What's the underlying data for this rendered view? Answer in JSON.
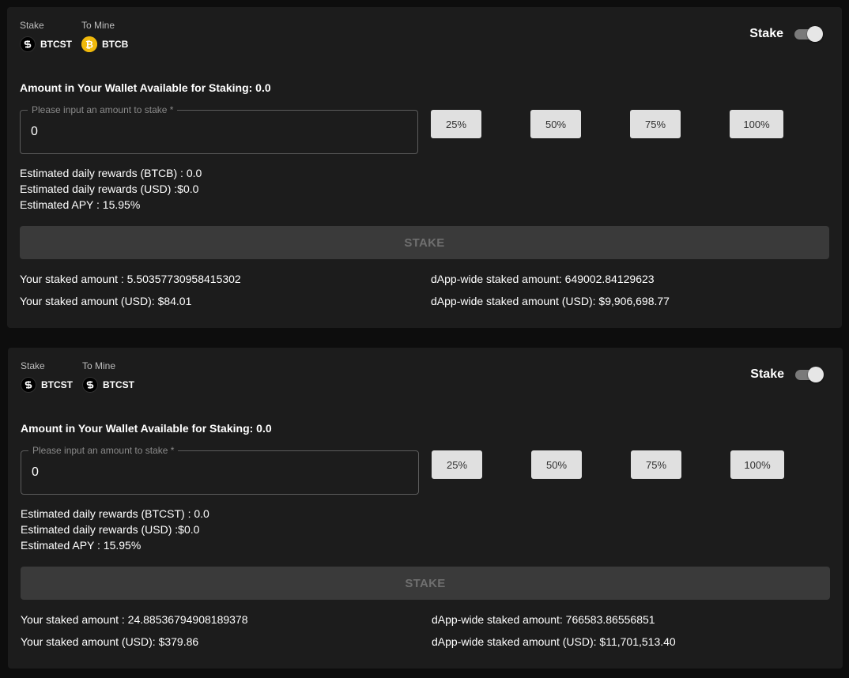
{
  "colors": {
    "background": "#0d0d0d",
    "card": "#1c1c1c",
    "button": "#e0e0e0",
    "stake_disabled": "#3a3a3a",
    "btcb_coin": "#f0b90b"
  },
  "pools": [
    {
      "stake_caption": "Stake",
      "mine_caption": "To Mine",
      "stake_token": {
        "name": "BTCST",
        "icon": "btcst-icon"
      },
      "mine_token": {
        "name": "BTCB",
        "icon": "bitcoin-icon"
      },
      "toggle_label": "Stake",
      "toggle_on": true,
      "wallet_text": "Amount in Your Wallet Available for Staking: 0.0",
      "input_placeholder": "Please input an amount to stake *",
      "input_value": "0",
      "percent_buttons": [
        "25%",
        "50%",
        "75%",
        "100%"
      ],
      "reward_token_line": "Estimated daily rewards (BTCB) : 0.0",
      "reward_usd_line": "Estimated daily rewards (USD) :$0.0",
      "apy_line": "Estimated APY : 15.95%",
      "stake_button": "STAKE",
      "your_staked": "Your staked amount : 5.50357730958415302",
      "your_staked_usd": "Your staked amount (USD): $84.01",
      "dapp_staked": "dApp-wide staked amount: 649002.84129623",
      "dapp_staked_usd": "dApp-wide staked amount (USD): $9,906,698.77"
    },
    {
      "stake_caption": "Stake",
      "mine_caption": "To Mine",
      "stake_token": {
        "name": "BTCST",
        "icon": "btcst-icon"
      },
      "mine_token": {
        "name": "BTCST",
        "icon": "btcst-icon"
      },
      "toggle_label": "Stake",
      "toggle_on": true,
      "wallet_text": "Amount in Your Wallet Available for Staking: 0.0",
      "input_placeholder": "Please input an amount to stake *",
      "input_value": "0",
      "percent_buttons": [
        "25%",
        "50%",
        "75%",
        "100%"
      ],
      "reward_token_line": "Estimated daily rewards (BTCST) : 0.0",
      "reward_usd_line": "Estimated daily rewards (USD) :$0.0",
      "apy_line": "Estimated APY : 15.95%",
      "stake_button": "STAKE",
      "your_staked": "Your staked amount : 24.88536794908189378",
      "your_staked_usd": "Your staked amount (USD): $379.86",
      "dapp_staked": "dApp-wide staked amount: 766583.86556851",
      "dapp_staked_usd": "dApp-wide staked amount (USD): $11,701,513.40"
    }
  ]
}
